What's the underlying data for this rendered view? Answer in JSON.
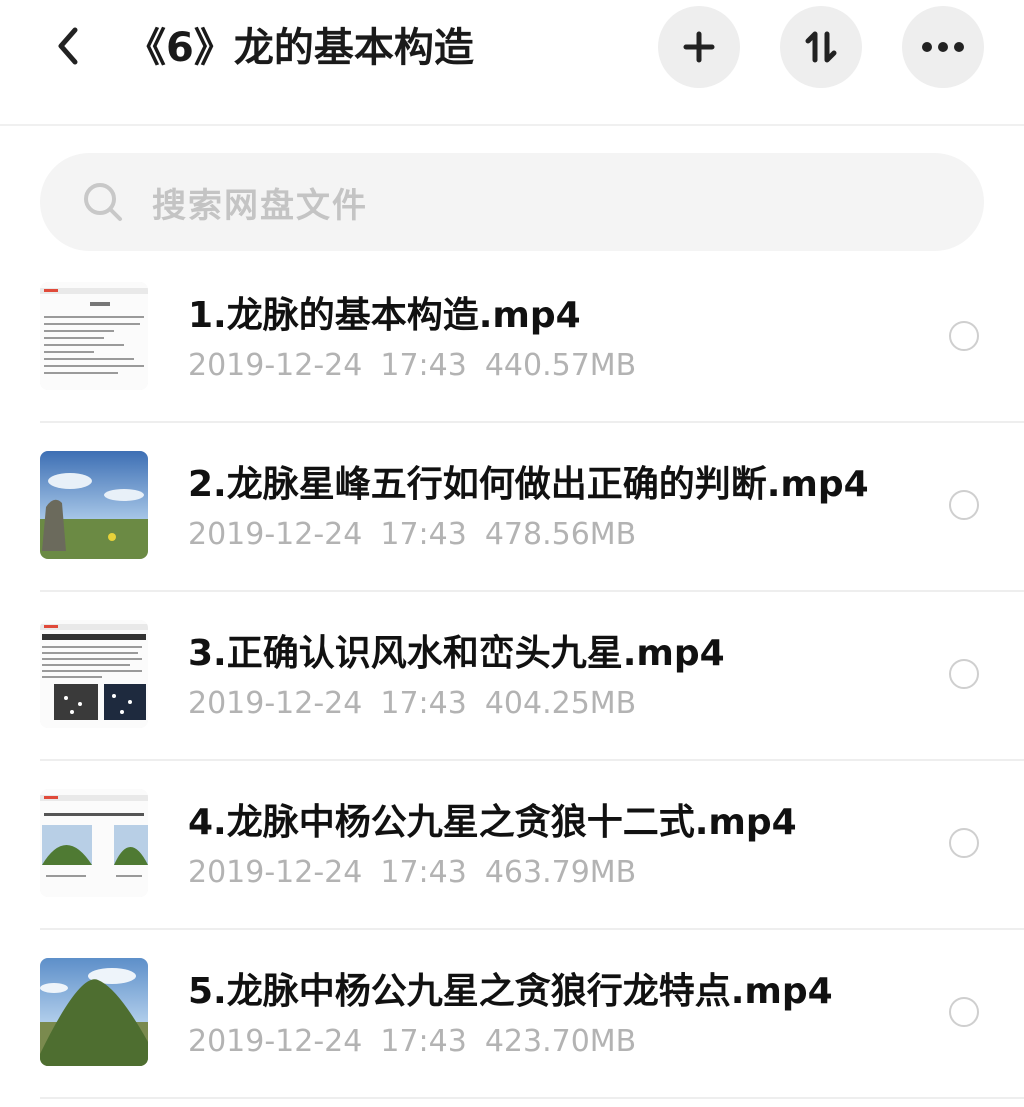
{
  "header": {
    "title": "《6》龙的基本构造",
    "add_icon": "plus-icon",
    "sort_icon": "sort-icon",
    "more_icon": "more-icon"
  },
  "search": {
    "placeholder": "搜索网盘文件"
  },
  "files": [
    {
      "name": "1.龙脉的基本构造.mp4",
      "date": "2019-12-24",
      "time": "17:43",
      "size": "440.57MB",
      "thumb": "document"
    },
    {
      "name": "2.龙脉星峰五行如何做出正确的判断.mp4",
      "date": "2019-12-24",
      "time": "17:43",
      "size": "478.56MB",
      "thumb": "landscape-rock"
    },
    {
      "name": "3.正确认识风水和峦头九星.mp4",
      "date": "2019-12-24",
      "time": "17:43",
      "size": "404.25MB",
      "thumb": "document-stars"
    },
    {
      "name": "4.龙脉中杨公九星之贪狼十二式.mp4",
      "date": "2019-12-24",
      "time": "17:43",
      "size": "463.79MB",
      "thumb": "document-hills"
    },
    {
      "name": "5.龙脉中杨公九星之贪狼行龙特点.mp4",
      "date": "2019-12-24",
      "time": "17:43",
      "size": "423.70MB",
      "thumb": "landscape-hill"
    }
  ]
}
